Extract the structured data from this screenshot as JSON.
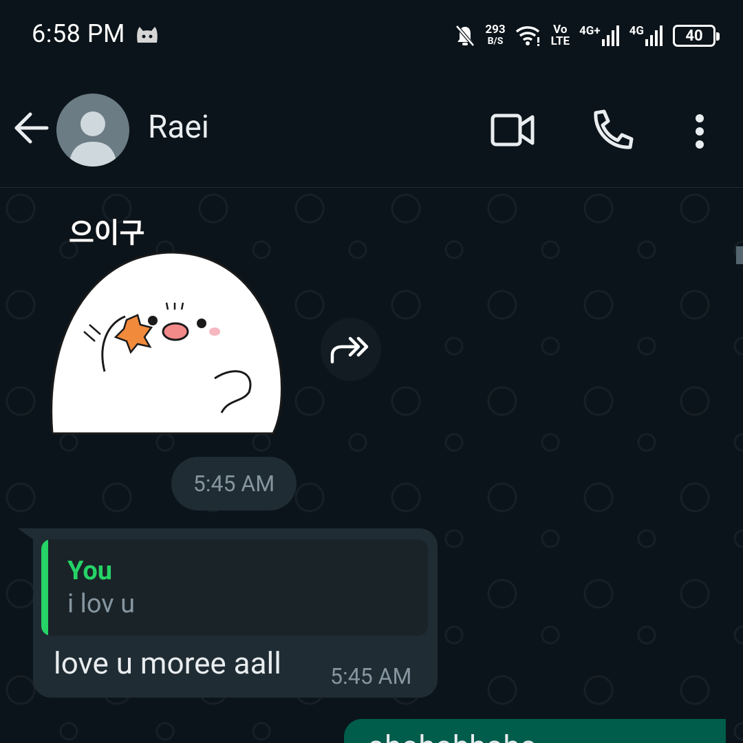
{
  "status_bar": {
    "time": "6:58 PM",
    "net_speed_value": "293",
    "net_speed_unit": "B/S",
    "volte_top": "Vo",
    "volte_bottom": "LTE",
    "sim1": "4G+",
    "sim2": "4G",
    "battery": "40"
  },
  "header": {
    "contact_name": "Raei"
  },
  "chat": {
    "sticker_text": "으이구",
    "sticker_time": "5:45 AM",
    "incoming_message": {
      "quote_author": "You",
      "quote_text": "i lov u",
      "text": "love u moree aall",
      "time": "5:45 AM"
    },
    "outgoing_message": {
      "text": "ohohohhoho"
    }
  },
  "colors": {
    "background": "#0b141a",
    "incoming_bubble": "#202c33",
    "outgoing_bubble": "#005c4b",
    "accent_green": "#25d366",
    "secondary_text": "#8696a0"
  }
}
